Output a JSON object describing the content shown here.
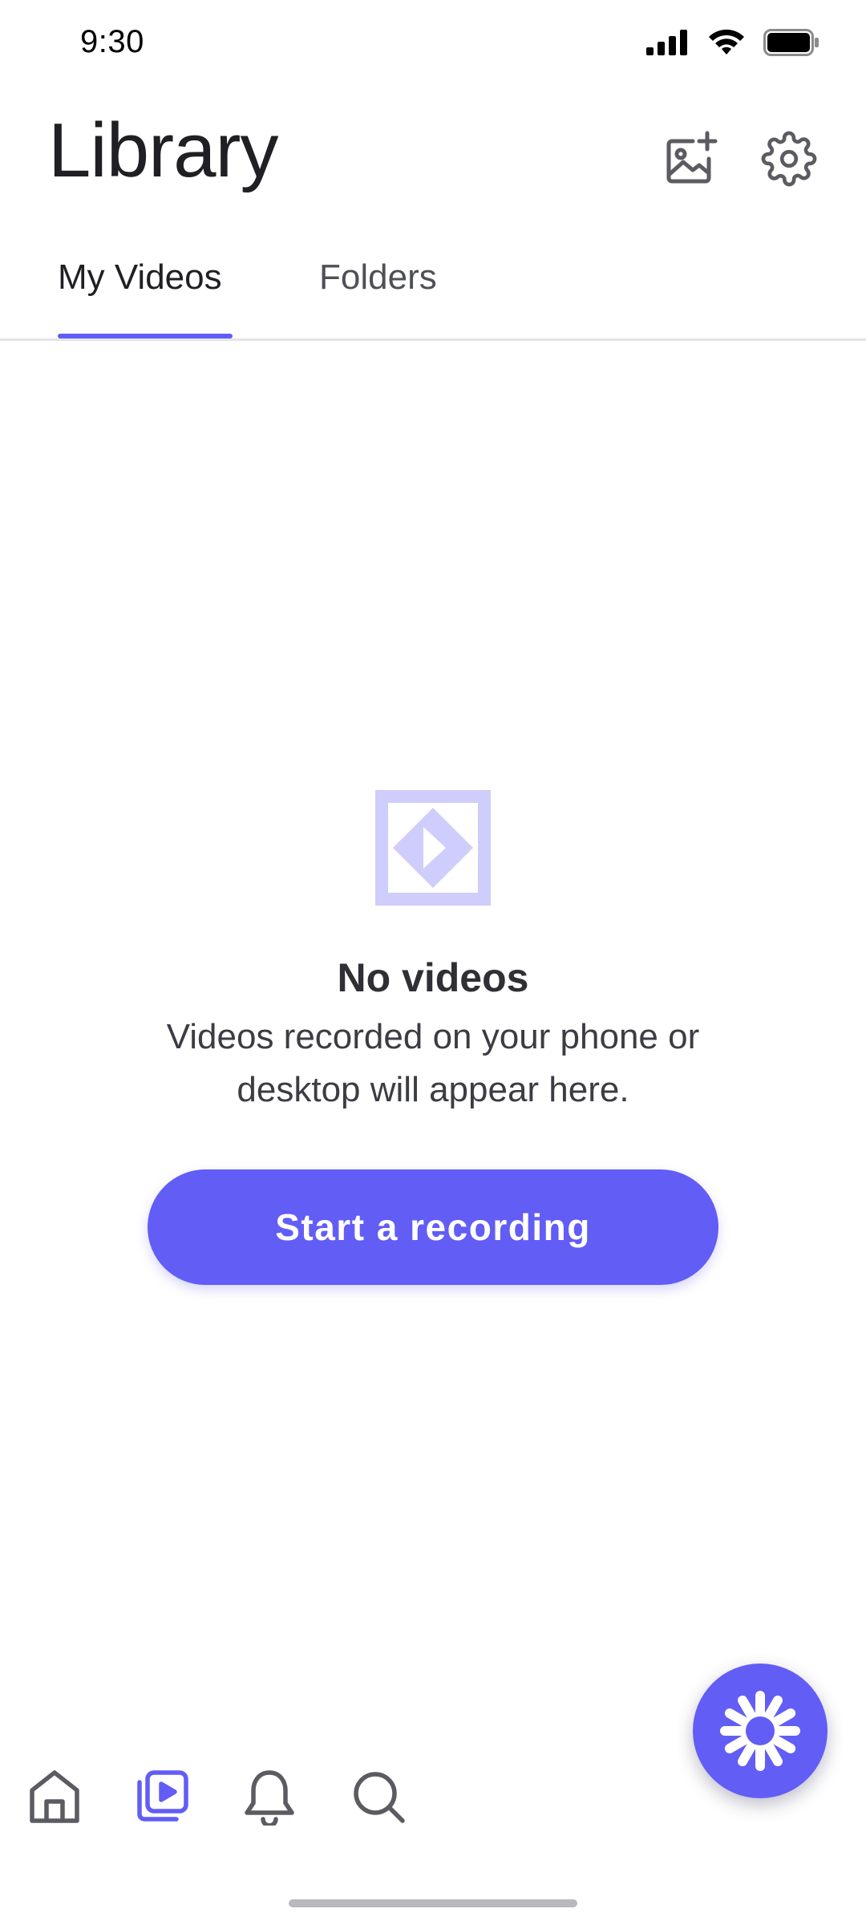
{
  "status_bar": {
    "time": "9:30"
  },
  "header": {
    "title": "Library"
  },
  "tabs": [
    {
      "label": "My Videos",
      "active": true
    },
    {
      "label": "Folders",
      "active": false
    }
  ],
  "empty_state": {
    "title": "No videos",
    "description": "Videos recorded on your phone or desktop will appear here.",
    "button_label": "Start a recording"
  },
  "icons": {
    "add_media": "image-plus-icon",
    "settings": "gear-icon",
    "fab": "sparkle-burst-icon",
    "nav_home": "home-icon",
    "nav_library": "video-library-icon",
    "nav_notifications": "bell-icon",
    "nav_search": "search-icon"
  },
  "colors": {
    "accent": "#625df5",
    "illustration_light": "#cfcdfb",
    "text_primary": "#1f1f24",
    "text_secondary": "#4f4f57",
    "nav_icon": "#5b5b62"
  }
}
